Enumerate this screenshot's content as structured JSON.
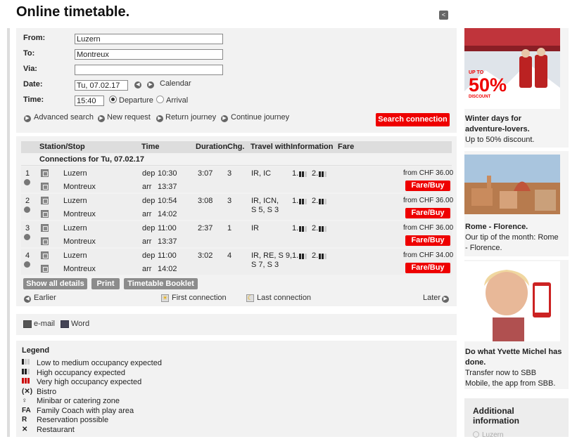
{
  "page_title": "Online timetable.",
  "form": {
    "from_label": "From:",
    "from_value": "Luzern",
    "to_label": "To:",
    "to_value": "Montreux",
    "via_label": "Via:",
    "via_value": "",
    "date_label": "Date:",
    "date_value": "Tu, 07.02.17",
    "calendar_label": "Calendar",
    "time_label": "Time:",
    "time_value": "15:40",
    "departure_label": "Departure",
    "arrival_label": "Arrival",
    "selected_mode": "Departure"
  },
  "links": {
    "advanced": "Advanced search",
    "new_request": "New request",
    "return_journey": "Return journey",
    "continue_journey": "Continue journey"
  },
  "search_button": "Search connection",
  "table": {
    "headers": [
      "Station/Stop",
      "Time",
      "Duration",
      "Chg.",
      "Travel with",
      "Information",
      "Fare"
    ],
    "date_header": "Connections for Tu, 07.02.17",
    "rows": [
      {
        "num": "1",
        "from": "Luzern",
        "to": "Montreux",
        "dep_label": "dep",
        "dep": "10:30",
        "arr_label": "arr",
        "arr": "13:37",
        "duration": "3:07",
        "changes": "3",
        "travel_1": "IR, IC",
        "travel_2": "",
        "occ_1": "1.",
        "occ_2": "2.",
        "fare": "from CHF 36.00",
        "buy": "Fare/Buy"
      },
      {
        "num": "2",
        "from": "Luzern",
        "to": "Montreux",
        "dep_label": "dep",
        "dep": "10:54",
        "arr_label": "arr",
        "arr": "14:02",
        "duration": "3:08",
        "changes": "3",
        "travel_1": "IR, ICN,",
        "travel_2": "S 5, S 3",
        "occ_1": "1.",
        "occ_2": "2.",
        "fare": "from CHF 36.00",
        "buy": "Fare/Buy"
      },
      {
        "num": "3",
        "from": "Luzern",
        "to": "Montreux",
        "dep_label": "dep",
        "dep": "11:00",
        "arr_label": "arr",
        "arr": "13:37",
        "duration": "2:37",
        "changes": "1",
        "travel_1": "IR",
        "travel_2": "",
        "occ_1": "1.",
        "occ_2": "2.",
        "fare": "from CHF 36.00",
        "buy": "Fare/Buy"
      },
      {
        "num": "4",
        "from": "Luzern",
        "to": "Montreux",
        "dep_label": "dep",
        "dep": "11:00",
        "arr_label": "arr",
        "arr": "14:02",
        "duration": "3:02",
        "changes": "4",
        "travel_1": "IR, RE, S 9,",
        "travel_2": "S 7, S 3",
        "occ_1": "1.",
        "occ_2": "2.",
        "fare": "from CHF 34.00",
        "buy": "Fare/Buy"
      }
    ]
  },
  "actions": {
    "show_all": "Show all details",
    "print": "Print",
    "booklet": "Timetable Booklet",
    "earlier": "Earlier",
    "first": "First connection",
    "last": "Last connection",
    "later": "Later"
  },
  "export": {
    "email": "e-mail",
    "word": "Word"
  },
  "legend": {
    "title": "Legend",
    "items": [
      {
        "icon": "low-occupancy-icon",
        "text": "Low to medium occupancy expected"
      },
      {
        "icon": "high-occupancy-icon",
        "text": "High occupancy expected"
      },
      {
        "icon": "very-high-occupancy-icon",
        "text": "Very high occupancy expected"
      },
      {
        "icon": "bistro-icon",
        "glyph": "(✕)",
        "text": "Bistro"
      },
      {
        "icon": "minibar-icon",
        "glyph": "♀",
        "text": "Minibar or catering zone"
      },
      {
        "icon": "family-coach-icon",
        "glyph": "FA",
        "text": "Family Coach with play area"
      },
      {
        "icon": "reservation-icon",
        "glyph": "R",
        "text": "Reservation possible"
      },
      {
        "icon": "restaurant-icon",
        "glyph": "✕",
        "text": "Restaurant"
      }
    ]
  },
  "sidebar": {
    "promo1": {
      "badge_top": "UP TO",
      "badge_pct": "50%",
      "badge_bottom": "DISCOUNT",
      "title": "Winter days for adventure-lovers.",
      "text": "Up to 50% discount."
    },
    "promo2": {
      "title": "Rome - Florence.",
      "text": "Our tip of the month: Rome - Florence."
    },
    "promo3": {
      "title": "Do what Yvette Michel has done.",
      "text": "Transfer now to SBB Mobile, the app from SBB."
    },
    "additional_title": "Additional information",
    "additional_item": "Luzern"
  },
  "colors": {
    "accent_red": "#e00000",
    "panel_gray": "#f2f2f2",
    "header_gray": "#dddddd"
  }
}
